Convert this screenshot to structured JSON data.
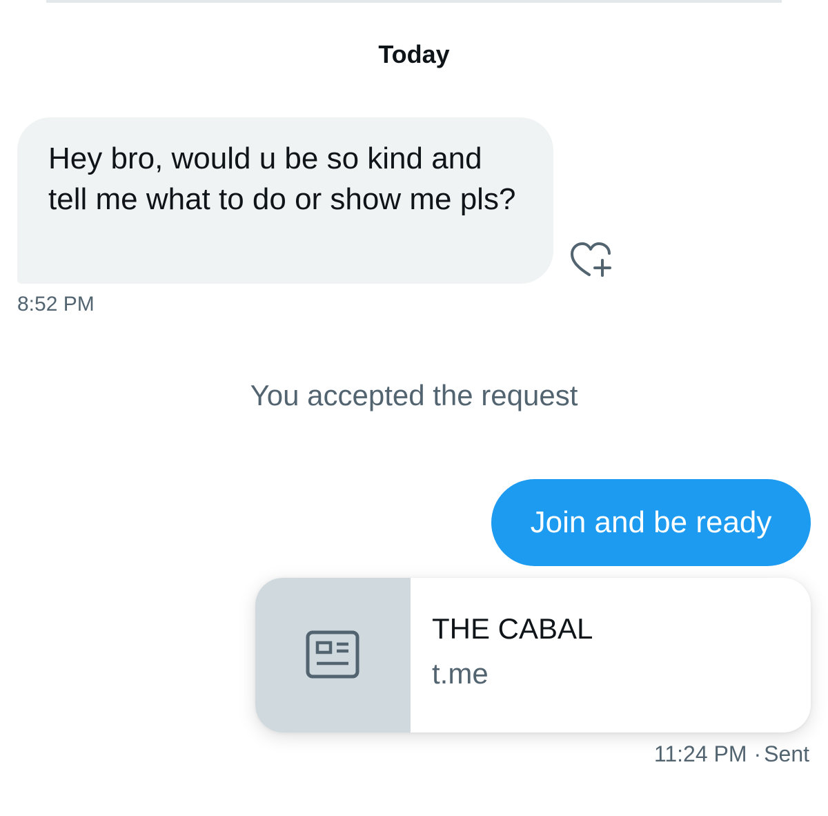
{
  "conversation": {
    "date_header": "Today",
    "received_message": {
      "text": "Hey bro, would u be so kind and tell me what to do or show me pls?",
      "time": "8:52 PM"
    },
    "reaction_icon": "heart-plus-icon",
    "system_note": "You accepted the request",
    "sent_message": {
      "text": "Join and be ready",
      "link_card": {
        "thumbnail_icon": "article-icon",
        "title": "THE CABAL",
        "domain": "t.me"
      },
      "time": "11:24 PM",
      "separator": "·",
      "status": "Sent"
    }
  },
  "colors": {
    "accent": "#1d9bf0",
    "received_bubble": "#eff3f4",
    "secondary_text": "#536471",
    "primary_text": "#0f1419",
    "thumbnail_bg": "#cfd9de"
  }
}
